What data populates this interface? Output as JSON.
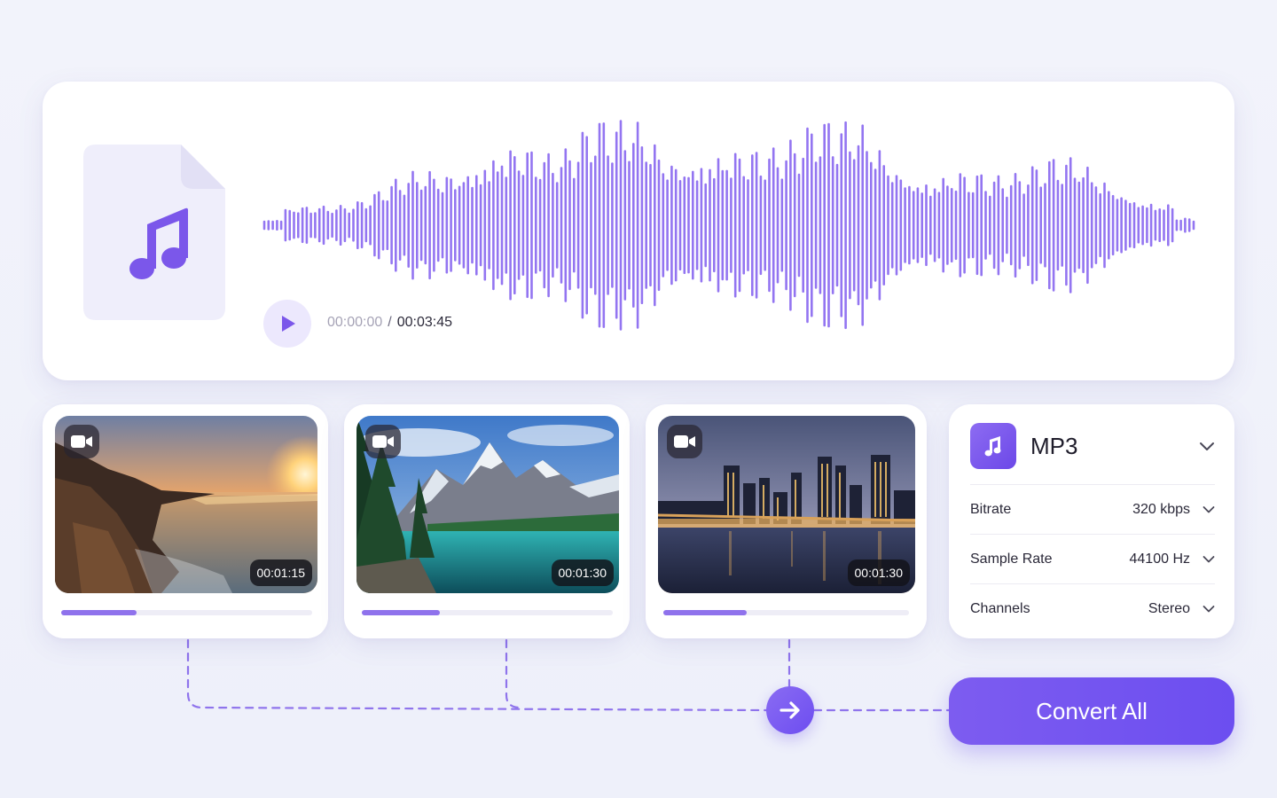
{
  "audio_player": {
    "current_time": "00:00:00",
    "separator": "/",
    "total_time": "00:03:45",
    "file_icon": "music-file-icon",
    "play_icon": "play-icon"
  },
  "videos": [
    {
      "duration": "00:01:15",
      "progress": 0.3,
      "scene": "coastal-sunset",
      "badge_icon": "video-camera-icon"
    },
    {
      "duration": "00:01:30",
      "progress": 0.31,
      "scene": "mountain-lake",
      "badge_icon": "video-camera-icon"
    },
    {
      "duration": "00:01:30",
      "progress": 0.34,
      "scene": "city-skyline-night",
      "badge_icon": "video-camera-icon"
    }
  ],
  "output_settings": {
    "format": "MP3",
    "format_icon": "music-note-icon",
    "rows": [
      {
        "label": "Bitrate",
        "value": "320 kbps"
      },
      {
        "label": "Sample Rate",
        "value": "44100 Hz"
      },
      {
        "label": "Channels",
        "value": "Stereo"
      }
    ]
  },
  "convert_button": {
    "label": "Convert All",
    "arrow_icon": "arrow-right-icon"
  },
  "colors": {
    "accent": "#7b5cf0",
    "accent_light": "#ece8fd",
    "waveform": "#8a6af0",
    "background": "#f0f1fa"
  }
}
